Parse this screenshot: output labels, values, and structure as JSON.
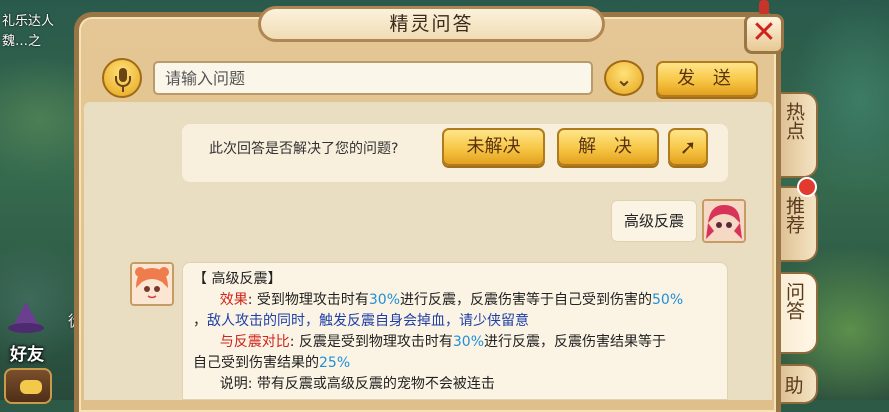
{
  "background": {
    "top_left_text_line1": "礼乐达人",
    "top_left_text_line2": "魏…之",
    "friend_label": "好友",
    "mid_label": "徒"
  },
  "window": {
    "title": "精灵问答",
    "close_symbol": "✕"
  },
  "search": {
    "placeholder": "请输入问题",
    "value": "",
    "dropdown_symbol": "⌄",
    "send_label": "发 送"
  },
  "feedback": {
    "question": "此次回答是否解决了您的问题?",
    "unresolved_label": "未解决",
    "resolved_label": "解 决",
    "share_symbol": "➚"
  },
  "conversation": {
    "user_message": "高级反震",
    "answer": {
      "heading": "【 高级反震】",
      "effect_label": "效果",
      "effect_text_1": ": 受到物理攻击时有",
      "effect_pct_1": "30%",
      "effect_text_2": "进行反震，反震伤害等于自己受到伤害的",
      "effect_pct_2": "50%",
      "effect_line2_prefix": "，",
      "effect_line2_text": "敌人攻击的同时，触发反震自身会掉血，请少侠留意",
      "compare_label": "与反震对比",
      "compare_text_1": ": 反震是受到物理攻击时有",
      "compare_pct_1": "30%",
      "compare_text_2": "进行反震，反震伤害结果等于",
      "compare_line2_text": "自己受到伤害结果的",
      "compare_pct_2": "25%",
      "note": "说明: 带有反震或高级反震的宠物不会被连击"
    }
  },
  "side_tabs": [
    {
      "label": "热点"
    },
    {
      "label": "推荐"
    },
    {
      "label": "问答"
    },
    {
      "label": "助"
    }
  ],
  "colors": {
    "accent_gold": "#f7c645",
    "highlight_red": "#d0231d",
    "percent_blue": "#1f8fd8",
    "warning_navy": "#1f3fa8"
  }
}
